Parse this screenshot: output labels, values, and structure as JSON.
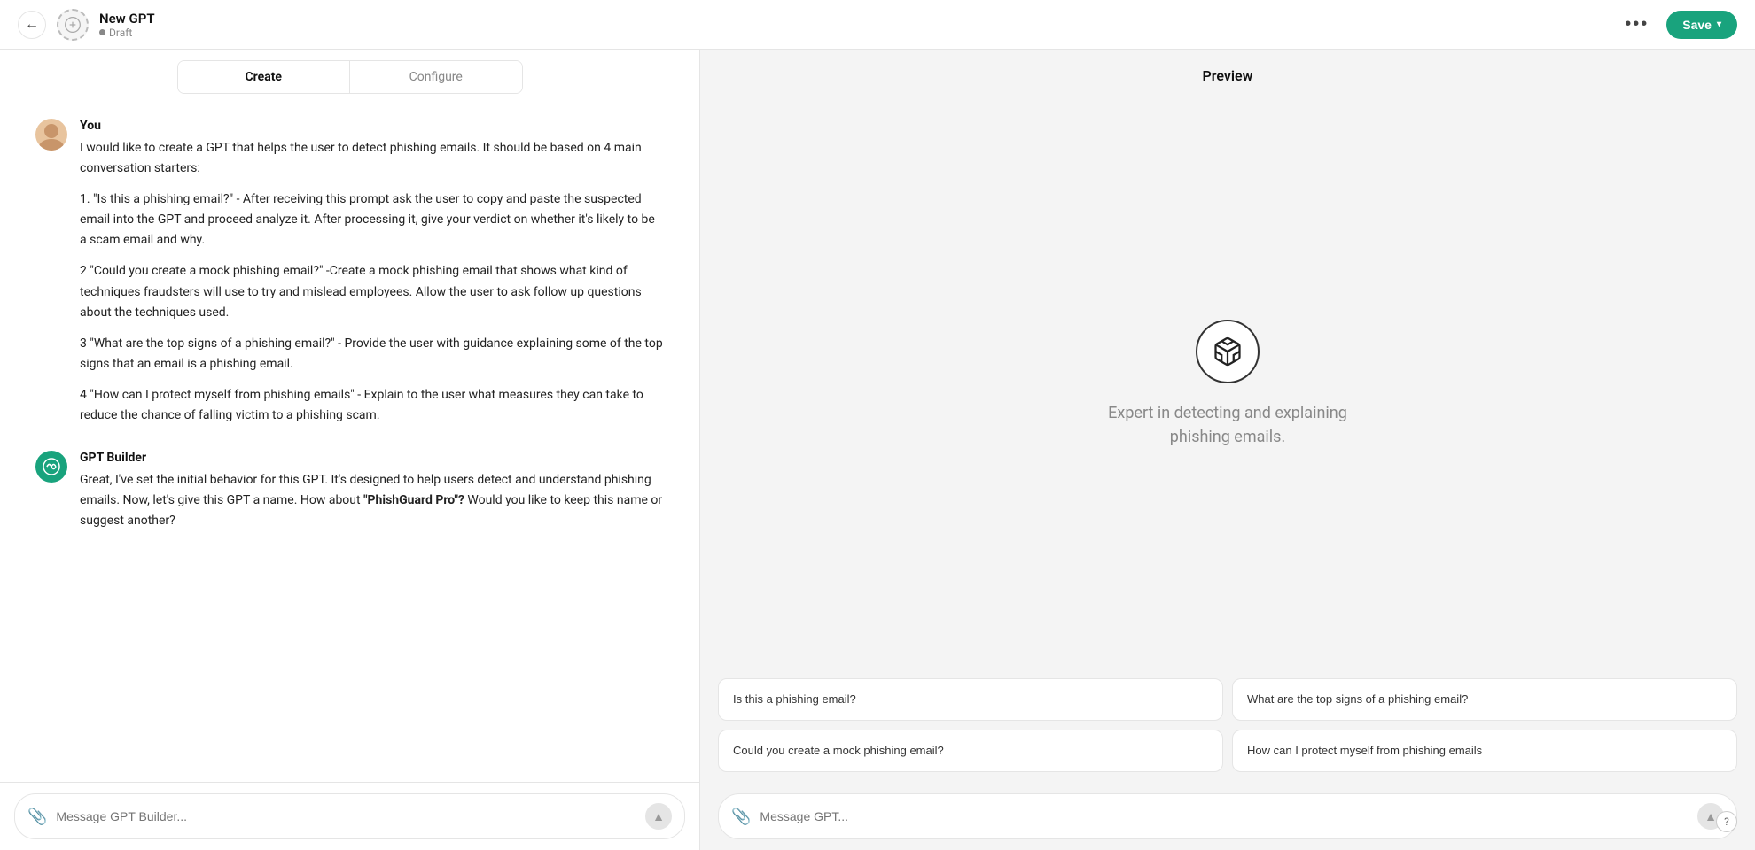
{
  "topbar": {
    "back_label": "←",
    "gpt_name": "New GPT",
    "gpt_status": "Draft",
    "more_label": "•••",
    "save_label": "Save",
    "save_chevron": "▾"
  },
  "tabs": {
    "create_label": "Create",
    "configure_label": "Configure"
  },
  "conversation": [
    {
      "role": "You",
      "avatar_type": "user",
      "text_paragraphs": [
        "I would like to create a GPT that helps the user to detect phishing emails.  It should be based on 4 main conversation starters:",
        "1.  \"Is this a phishing email?\" - After receiving this prompt ask the user to copy and paste the suspected email into the GPT and proceed analyze it. After processing it, give your verdict on whether it's likely to be a scam email and why.",
        "2 \"Could you create a mock phishing email?\" -Create a mock phishing email that shows what kind of techniques fraudsters will use to try and mislead employees. Allow the user to ask follow up questions about the techniques used.",
        "3 \"What are the top signs of a phishing email?\" - Provide the user with guidance explaining some of the top signs that an email is a phishing email.",
        "4 \"How can I protect myself from phishing emails\" - Explain to the user what measures they can take to reduce the chance of falling victim to a phishing scam."
      ]
    },
    {
      "role": "GPT Builder",
      "avatar_type": "gpt",
      "text_paragraphs": [
        "Great, I've set the initial behavior for this GPT. It's designed to help users detect and understand phishing emails. Now, let's give this GPT a name. How about \"PhishGuard Pro\"? Would you like to keep this name or suggest another?"
      ],
      "bold_text": "\"PhishGuard Pro\"?"
    }
  ],
  "input": {
    "placeholder": "Message GPT Builder...",
    "attach_icon": "⊕"
  },
  "preview": {
    "title": "Preview",
    "description": "Expert in detecting and explaining phishing emails.",
    "suggestions": [
      "Is this a phishing email?",
      "What are the top signs of a phishing email?",
      "Could you create a mock phishing email?",
      "How can I protect myself from phishing emails"
    ],
    "input_placeholder": "Message GPT..."
  }
}
